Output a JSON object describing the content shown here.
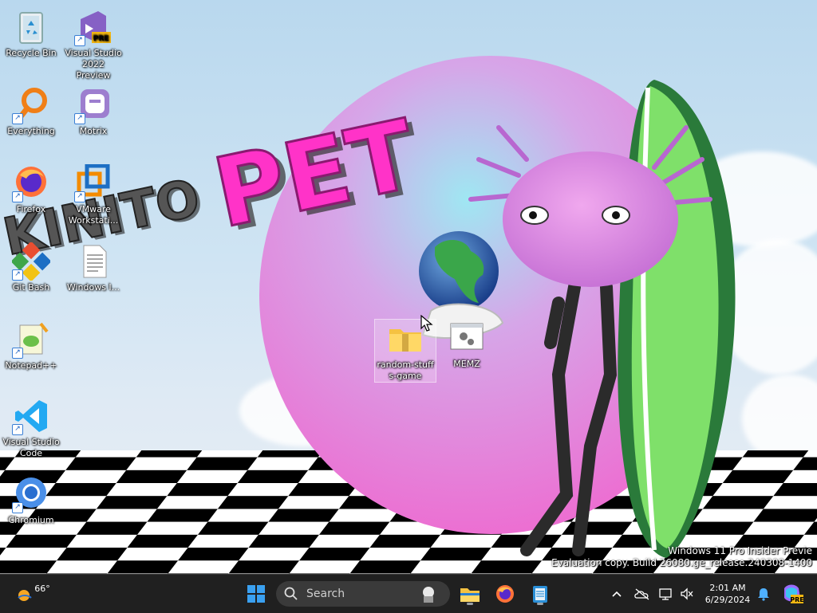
{
  "desktop": {
    "icons": [
      {
        "label": "Recycle Bin",
        "icon": "recycle-bin-icon"
      },
      {
        "label": "Visual Studio 2022 Preview",
        "icon": "visual-studio-preview-icon",
        "badge": "PRE"
      },
      {
        "label": "Everything",
        "icon": "everything-search-icon"
      },
      {
        "label": "Motrix",
        "icon": "motrix-icon"
      },
      {
        "label": "Firefox",
        "icon": "firefox-icon"
      },
      {
        "label": "VMware Workstati...",
        "icon": "vmware-icon"
      },
      {
        "label": "Git Bash",
        "icon": "git-bash-icon"
      },
      {
        "label": "Windows I...",
        "icon": "text-document-icon"
      },
      {
        "label": "Notepad++",
        "icon": "notepad-plus-plus-icon"
      },
      {
        "label": "Visual Studio Code",
        "icon": "vscode-icon"
      },
      {
        "label": "Chromium",
        "icon": "chromium-icon"
      },
      {
        "label": "random-stuffs-game",
        "icon": "zip-folder-icon"
      },
      {
        "label": "MEMZ",
        "icon": "executable-icon"
      }
    ],
    "wallpaper": {
      "text_dark": "KINITO",
      "text_pink": "PET"
    },
    "watermark": {
      "line1": "Windows 11 Pro Insider Previe",
      "line2": "Evaluation copy. Build 26080.ge_release.240308-1400"
    }
  },
  "taskbar": {
    "weather": {
      "temp": "66°",
      "icon": "weather-sun-icon"
    },
    "search": {
      "placeholder": "Search"
    },
    "apps": [
      "start-icon",
      "file-explorer-icon",
      "firefox-icon",
      "notepad-icon"
    ],
    "tray": {
      "time": "2:01 AM",
      "date": "6/29/2024",
      "icons": [
        "chevron-up-icon",
        "onedrive-offline-icon",
        "network-icon",
        "volume-muted-icon",
        "notification-bell-icon",
        "copilot-icon"
      ],
      "copilot_badge": "PRE"
    }
  },
  "colors": {
    "taskbar_bg": "#202020",
    "pink": "#ff33c8",
    "accent_blue": "#0078d4"
  }
}
